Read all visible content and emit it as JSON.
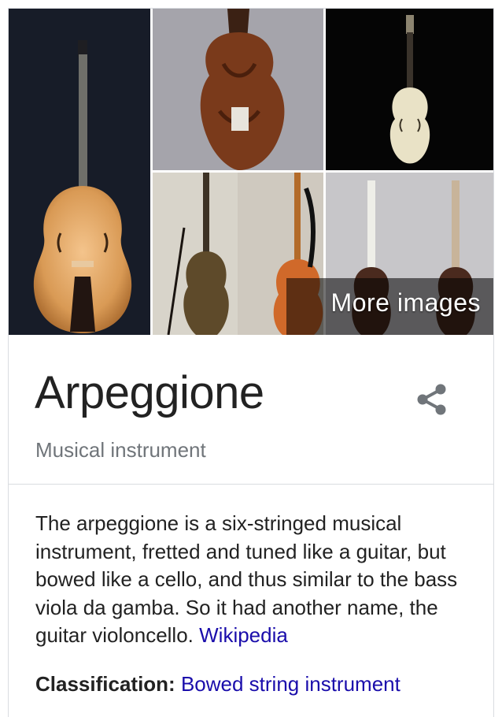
{
  "images": {
    "more_label": "More images",
    "tiles": [
      {
        "name": "arpeggione-image-1"
      },
      {
        "name": "arpeggione-image-2"
      },
      {
        "name": "arpeggione-image-3"
      },
      {
        "name": "arpeggione-image-4"
      },
      {
        "name": "arpeggione-image-5"
      }
    ]
  },
  "entity": {
    "title": "Arpeggione",
    "subtitle": "Musical instrument",
    "share_icon": "share-icon"
  },
  "description": {
    "text": "The arpeggione is a six-stringed musical instrument, fretted and tuned like a guitar, but bowed like a cello, and thus similar to the bass viola da gamba. So it had another name, the guitar violoncello.",
    "source_link": "Wikipedia"
  },
  "facts": {
    "classification_label": "Classification:",
    "classification_value": "Bowed string instrument"
  },
  "colors": {
    "link": "#1a0dab",
    "subtitle": "#70757a",
    "text": "#222222",
    "divider": "#dadce0"
  }
}
